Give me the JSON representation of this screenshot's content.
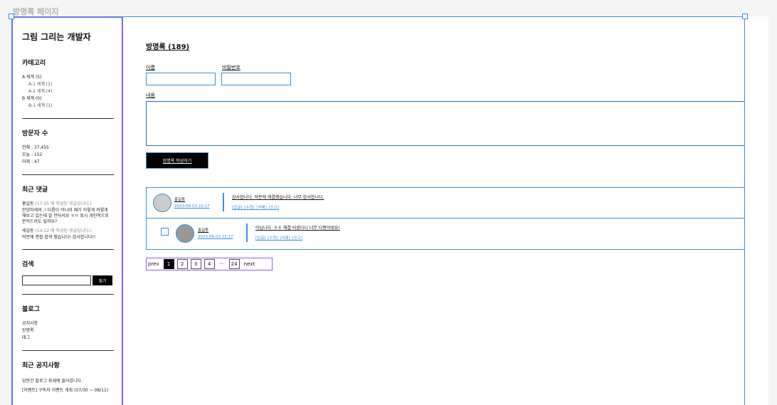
{
  "frame_label": "방명록 페이지",
  "sidebar": {
    "blog_title": "그림 그리는 개발자",
    "category": {
      "title": "카테고리",
      "items": [
        {
          "label": "A 세계 (5)",
          "indent": false
        },
        {
          "label": "A-1 세계 (1)",
          "indent": true
        },
        {
          "label": "A-2 세계 (4)",
          "indent": true
        },
        {
          "label": "B 세계 (0)",
          "indent": false
        },
        {
          "label": "B-1 세계 (1)",
          "indent": true
        }
      ]
    },
    "visitors": {
      "title": "방문자 수",
      "total": "전체 : 37,455",
      "today": "오늘 : 152",
      "yesterday": "어제 : 47"
    },
    "recent_comments": {
      "title": "최근 댓글",
      "items": [
        {
          "author": "홍길동",
          "meta": "(17:35 에 작성된 댓글입니다.)",
          "text": "안녕하세여..! 다름이 아니라 제가 이렇게 저렇게 해보고 있는데 잘 안되서요 ㅠㅠ 혹시 개인적으로 문의드려도 될까요?"
        },
        {
          "author": "세길동",
          "meta": "(14:12 에 작성된 댓글입니다.)",
          "text": "덕분에 면접 합격 했습니다! 감사합니다!!"
        }
      ]
    },
    "search": {
      "title": "검색",
      "button": "찾기",
      "value": ""
    },
    "blog": {
      "title": "블로그",
      "links": [
        "공지사항",
        "방명록",
        "태그"
      ]
    },
    "notices": {
      "title": "최근 공지사항",
      "items": [
        "당분간 블로그 휴재에 들어갑니다.",
        "[이벤트] 구독자 이벤트 개최 (07/30 ~ 08/11)"
      ]
    }
  },
  "guestbook": {
    "title": "방명록 (189)",
    "name_label": "이름",
    "password_label": "비밀번호",
    "content_label": "내용",
    "name_value": "",
    "password_value": "",
    "content_value": "",
    "submit_label": "방명록 작성하기",
    "comments": [
      {
        "name": "홍길동",
        "date": "2023-08-03 22:17",
        "text": "감사합니다. 덕분에 해결했습니다. 너무 감사합니다.",
        "actions": "[답글] [수정] [삭제] [신고]",
        "is_reply": false
      },
      {
        "name": "홍길동",
        "date": "2023-08-03 22:17",
        "text": "아닙니다. ㅎㅎ 해결 되셨다니 너무 다행이네요!",
        "actions": "[답글] [수정] [삭제] [신고]",
        "is_reply": true
      }
    ],
    "pagination": {
      "prev": "prev",
      "next": "next",
      "pages": [
        "1",
        "2",
        "3",
        "4",
        "···",
        "24"
      ],
      "current": "1"
    }
  },
  "colors": {
    "selection_blue": "#3b8fe0",
    "frame_purple": "#8b5cf6",
    "avatar_reply": "#999999",
    "avatar_main": "#cccccc"
  }
}
